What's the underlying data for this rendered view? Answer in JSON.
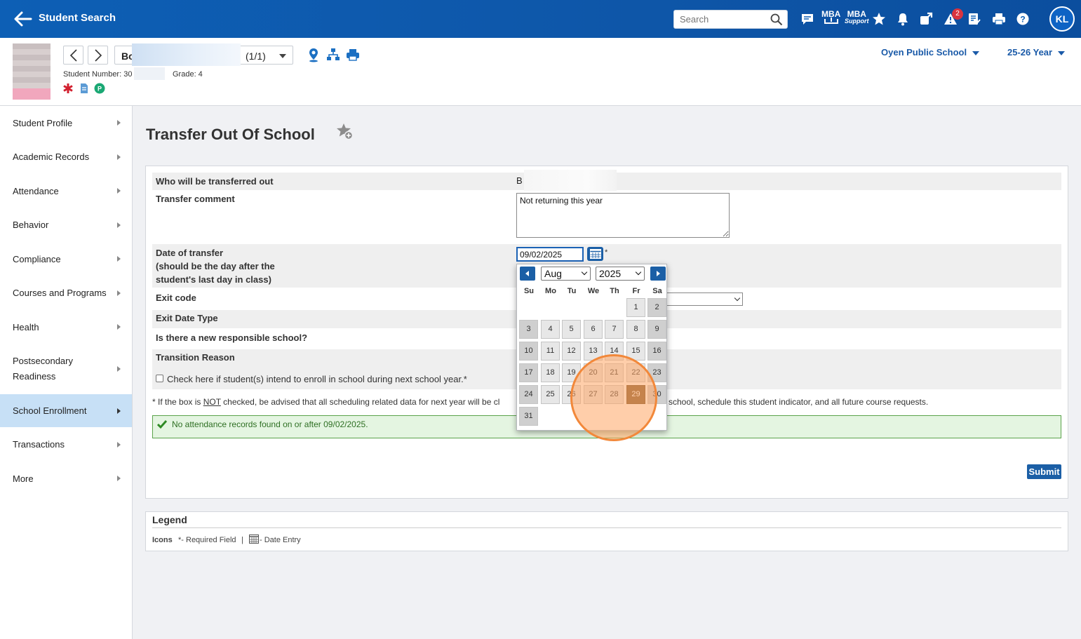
{
  "topbar": {
    "title": "Student Search",
    "search_placeholder": "Search",
    "mba_label": "MBA",
    "mba_support_label_1": "MBA",
    "mba_support_label_2": "Support",
    "alert_count": "2",
    "avatar_initials": "KL"
  },
  "student": {
    "name_prefix": "Bo",
    "count": "(1/1)",
    "number_label": "Student Number: 30",
    "grade_label": "Grade: 4",
    "school": "Oyen Public School",
    "year": "25-26 Year"
  },
  "sidebar": {
    "items": [
      {
        "label": "Student Profile"
      },
      {
        "label": "Academic Records"
      },
      {
        "label": "Attendance"
      },
      {
        "label": "Behavior"
      },
      {
        "label": "Compliance"
      },
      {
        "label": "Courses and Programs"
      },
      {
        "label": "Health"
      },
      {
        "label": "Postsecondary Readiness"
      },
      {
        "label": "School Enrollment"
      },
      {
        "label": "Transactions"
      },
      {
        "label": "More"
      }
    ]
  },
  "page": {
    "title": "Transfer Out Of School"
  },
  "form": {
    "who_label": "Who will be transferred out",
    "who_value": "B",
    "comment_label": "Transfer comment",
    "comment_value": "Not returning this year",
    "date_label_1": "Date of transfer",
    "date_label_2": "(should be the day after the",
    "date_label_3": "student's last day in class)",
    "date_value": "09/02/2025",
    "required_star": "*",
    "exit_code_label": "Exit code",
    "exit_date_type_label": "Exit Date Type",
    "responsible_label": "Is there a new responsible school?",
    "transition_label": "Transition Reason",
    "checkbox_label": "Check here if student(s) intend to enroll in school during next school year.*",
    "note_prefix": "* If the box is ",
    "note_not": "NOT",
    "note_middle": " checked, be advised that all scheduling related data for next year will be cl",
    "note_end": "school, schedule this student indicator, and all future course requests.",
    "success_message": "No attendance records found on or after 09/02/2025.",
    "submit_label": "Submit"
  },
  "legend": {
    "title": "Legend",
    "icons_label": "Icons",
    "required_label": "*- Required Field",
    "separator": "|",
    "date_entry_label": "- Date Entry"
  },
  "datepicker": {
    "month": "Aug",
    "year": "2025",
    "weekdays": [
      "Su",
      "Mo",
      "Tu",
      "We",
      "Th",
      "Fr",
      "Sa"
    ],
    "first_weekday_index": 5,
    "days_in_month": 31,
    "selected_day": 29
  },
  "colors": {
    "brand_blue": "#0d5fb5",
    "button_blue": "#1b5fa6",
    "selected_day": "#7f5a2f",
    "success_bg": "#e4f5e1",
    "highlight_ring": "#f2883a"
  }
}
